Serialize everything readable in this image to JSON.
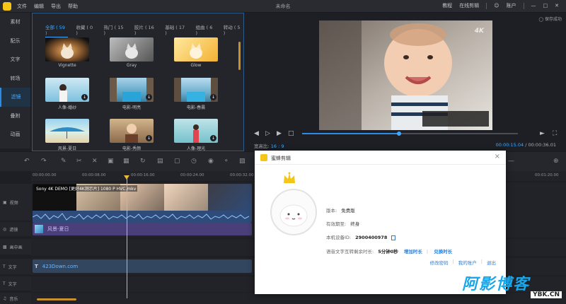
{
  "app": {
    "title": "未命名"
  },
  "menu": [
    "文件",
    "编辑",
    "导出",
    "帮助"
  ],
  "titlebar_right": {
    "tutorial": "教程",
    "online_edit": "在线剪辑",
    "account": "账户"
  },
  "leftnav": [
    {
      "label": "素材",
      "active": false
    },
    {
      "label": "配乐",
      "active": false
    },
    {
      "label": "文字",
      "active": false
    },
    {
      "label": "转场",
      "active": false
    },
    {
      "label": "滤镜",
      "active": true
    },
    {
      "label": "叠附",
      "active": false
    },
    {
      "label": "动画",
      "active": false
    }
  ],
  "filter_tabs": [
    {
      "label": "全部 ( 59 )",
      "active": true
    },
    {
      "label": "收藏 ( 0 )",
      "active": false
    },
    {
      "label": "热门 ( 15 )",
      "active": false
    },
    {
      "label": "胶片 ( 16 )",
      "active": false
    },
    {
      "label": "基础 ( 17 )",
      "active": false
    },
    {
      "label": "组曲 ( 6 )",
      "active": false
    },
    {
      "label": "转动 ( 5 )",
      "active": false
    }
  ],
  "filters": [
    {
      "label": "Vignette",
      "download": false
    },
    {
      "label": "Gray",
      "download": false
    },
    {
      "label": "Glow",
      "download": false
    },
    {
      "label": "人像-婚纱",
      "download": true
    },
    {
      "label": "电影-明亮",
      "download": true
    },
    {
      "label": "电影-春晨",
      "download": true
    },
    {
      "label": "风景-夏日",
      "download": false
    },
    {
      "label": "电影-秀颜",
      "download": true
    },
    {
      "label": "人像-理光",
      "download": true
    }
  ],
  "preview": {
    "keep": "保存成功",
    "watermark": "4K",
    "ratio_label": "宽高比:",
    "ratio_value": "16 : 9",
    "time_current": "00:00:15.04",
    "time_sep": " / ",
    "time_total": "00:00:36.01",
    "progress": 0.45
  },
  "ruler": [
    "00:00:00.00",
    "00:00:08.00",
    "00:00:16.00",
    "00:00:24.00",
    "00:00:32.00",
    "00:01:20.00"
  ],
  "tracks": [
    {
      "label": "视频"
    },
    {
      "label": "滤镜"
    },
    {
      "label": "画中画"
    },
    {
      "label": "文字"
    },
    {
      "label": "文字"
    },
    {
      "label": "音乐"
    }
  ],
  "clips": {
    "video_label": "Sony 4K DEMO [更好4K测示片] 1080 P HVC.mkv",
    "filter_label": "风景-夏日",
    "text_label": "423Down.com"
  },
  "dialog": {
    "title": "蜜蜂剪辑",
    "version_label": "版本:",
    "version_value": "免费版",
    "expiry_label": "有效期至:",
    "expiry_value": "终身",
    "device_label": "本机设备ID:",
    "device_value": "2900400978",
    "speech_label": "语音文字互转剩余时长:",
    "speech_value": "5分钟0秒",
    "add_time": "增加时长",
    "redeem_time": "兑换时长",
    "change_password": "修改密码",
    "my_account": "我的账户",
    "logout": "退出"
  },
  "site_watermark": {
    "big": "阿影博客",
    "small": "YBK.CN"
  },
  "colors": {
    "accent": "#43a9ff",
    "playhead": "#e9b93a",
    "brand": "#f5c518",
    "link": "#2b7fd9"
  }
}
